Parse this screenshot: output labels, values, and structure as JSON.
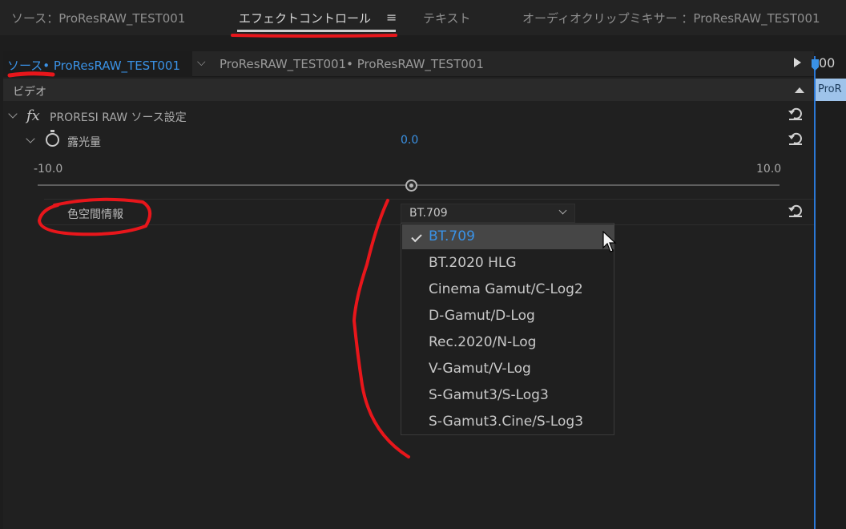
{
  "tabs": [
    {
      "label": "ソース：ProResRAW_TEST001",
      "active": false
    },
    {
      "label": "エフェクトコントロール",
      "active": true
    },
    {
      "label": "テキスト",
      "active": false
    },
    {
      "label": "オーディオクリップミキサー ：ProResRAW_TEST001",
      "active": false
    }
  ],
  "menu_icon": "≡",
  "source_row": {
    "active": "ソース• ProResRAW_TEST001",
    "other": "ProResRAW_TEST001• ProResRAW_TEST001"
  },
  "timeline": {
    "time": "00",
    "clip_label": "ProR"
  },
  "video_label": "ビデオ",
  "effect": {
    "fx_symbol": "fx",
    "name": "PRORESI  RAW ソース設定",
    "exposure": {
      "label": "露光量",
      "value": "0.0",
      "min_label": "-10.0",
      "max_label": "10.0",
      "level": 0.5
    },
    "colorspace": {
      "label": "色空間情報",
      "value": "BT.709"
    }
  },
  "dropdown": {
    "options": [
      "BT.709",
      "BT.2020 HLG",
      "Cinema Gamut/C-Log2",
      "D-Gamut/D-Log",
      "Rec.2020/N-Log",
      "V-Gamut/V-Log",
      "S-Gamut3/S-Log3",
      "S-Gamut3.Cine/S-Log3"
    ],
    "selected_index": 0
  },
  "colors": {
    "accent": "#3a92e6",
    "annotation": "#e8161b",
    "background": "#1d1d1d"
  }
}
